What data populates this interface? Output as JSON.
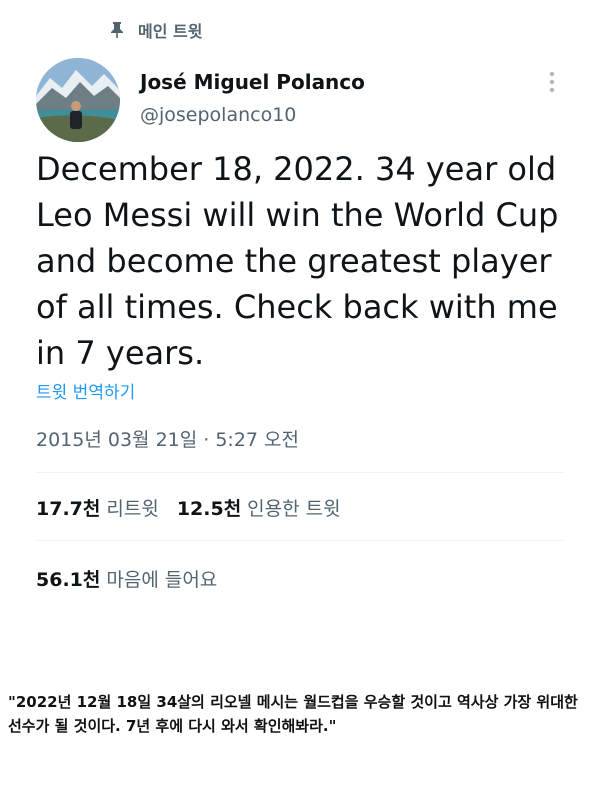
{
  "pinned": {
    "label": "메인 트윗",
    "icon": "pin-icon"
  },
  "author": {
    "name": "José Miguel Polanco",
    "handle": "@josepolanco10"
  },
  "tweet": {
    "text": "December 18, 2022. 34 year old Leo Messi will win the World Cup and become the greatest player of all times. Check back with me in 7 years.",
    "translate_label": "트윗 번역하기",
    "timestamp": "2015년 03월 21일 · 5:27 오전"
  },
  "stats": {
    "retweets_count": "17.7천",
    "retweets_label": "리트윗",
    "quotes_count": "12.5천",
    "quotes_label": "인용한 트윗",
    "likes_count": "56.1천",
    "likes_label": "마음에 들어요"
  },
  "caption": "\"2022년 12월 18일 34살의 리오넬 메시는 월드컵을 우승할 것이고 역사상 가장 위대한 선수가 될 것이다. 7년 후에 다시 와서 확인해봐라.\"",
  "colors": {
    "accent": "#1d9bf0",
    "secondary_text": "#536471",
    "primary_text": "#0f1419"
  }
}
